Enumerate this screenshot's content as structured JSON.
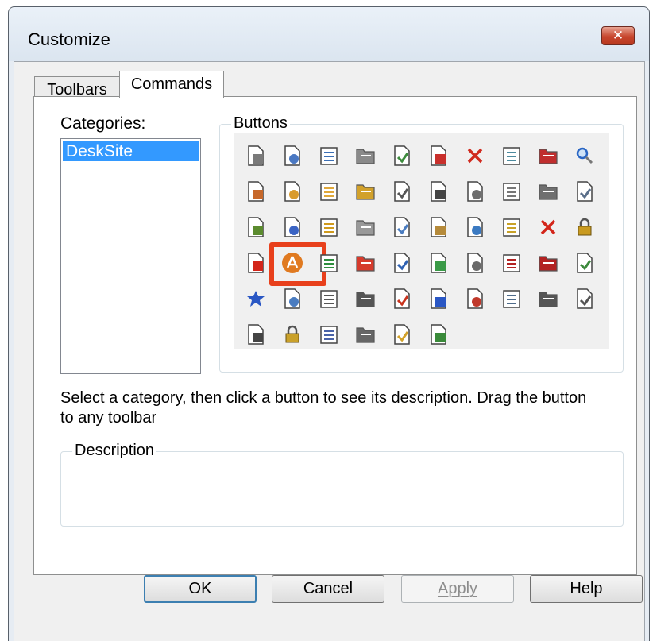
{
  "window": {
    "title": "Customize",
    "close_label": "✕"
  },
  "tabs": [
    {
      "label": "Toolbars",
      "active": false
    },
    {
      "label": "Commands",
      "active": true
    }
  ],
  "categories": {
    "label": "Categories:",
    "items": [
      "DeskSite"
    ],
    "selected": "DeskSite"
  },
  "buttons_group": {
    "label": "Buttons",
    "icons": [
      {
        "name": "print-icon",
        "color": "#7a7a7a"
      },
      {
        "name": "print-preview-icon",
        "color": "#4a78c2"
      },
      {
        "name": "refresh-document-icon",
        "color": "#3b6fb6"
      },
      {
        "name": "find-document-icon",
        "color": "#8a8a8a"
      },
      {
        "name": "document-export-icon",
        "color": "#3d8c3d"
      },
      {
        "name": "copy-document-icon",
        "color": "#c9302c"
      },
      {
        "name": "delete-document-icon",
        "color": "#d02a1e"
      },
      {
        "name": "database-document-icon",
        "color": "#4c8a9e"
      },
      {
        "name": "document-list-icon",
        "color": "#c02e2e"
      },
      {
        "name": "search-icon",
        "color": "#2a66c4"
      },
      {
        "name": "folder-photo-icon",
        "color": "#c7682a"
      },
      {
        "name": "folder-open-icon",
        "color": "#d89a2c"
      },
      {
        "name": "folder-icon",
        "color": "#e0a83a"
      },
      {
        "name": "print-queue-icon",
        "color": "#d2a12b"
      },
      {
        "name": "binoculars-icon",
        "color": "#555555"
      },
      {
        "name": "search-folder-icon",
        "color": "#444444"
      },
      {
        "name": "mail-document-icon",
        "color": "#6e6e6e"
      },
      {
        "name": "stacked-documents-icon",
        "color": "#777777"
      },
      {
        "name": "documents-icon",
        "color": "#6f6f6f"
      },
      {
        "name": "edit-document-icon",
        "color": "#5b6f8a"
      },
      {
        "name": "check-document-icon",
        "color": "#5b8b2e"
      },
      {
        "name": "forward-document-icon",
        "color": "#3b64c4"
      },
      {
        "name": "edit-pen-icon",
        "color": "#d09b1e"
      },
      {
        "name": "copy-outline-icon",
        "color": "#999999"
      },
      {
        "name": "paste-icon",
        "color": "#4a7cc0"
      },
      {
        "name": "hand-document-icon",
        "color": "#b58a3a"
      },
      {
        "name": "document-set-icon",
        "color": "#3b7ac2"
      },
      {
        "name": "new-document-icon",
        "color": "#c9a227"
      },
      {
        "name": "close-icon",
        "color": "#d3251a"
      },
      {
        "name": "lock-open-icon",
        "color": "#c99a1f"
      },
      {
        "name": "remove-document-icon",
        "color": "#d3251a"
      },
      {
        "name": "acrobat-icon",
        "color": "#e07a20"
      },
      {
        "name": "refresh-green-icon",
        "color": "#2e8f3e"
      },
      {
        "name": "pdf-icon",
        "color": "#d63b2c"
      },
      {
        "name": "word-document-icon",
        "color": "#2f62b3"
      },
      {
        "name": "add-document-icon",
        "color": "#3a9a47"
      },
      {
        "name": "text-document-icon",
        "color": "#6a6a6a"
      },
      {
        "name": "pdf-document-icon",
        "color": "#b32222"
      },
      {
        "name": "pdf-export-icon",
        "color": "#b32222"
      },
      {
        "name": "document-compare-icon",
        "color": "#3c8a3c"
      },
      {
        "name": "favorite-star-icon",
        "color": "#2a57c4"
      },
      {
        "name": "document-lines-icon",
        "color": "#4a7cc0"
      },
      {
        "name": "list-icon",
        "color": "#555555"
      },
      {
        "name": "copy-icon",
        "color": "#555555"
      },
      {
        "name": "schedule-icon",
        "color": "#c8331d"
      },
      {
        "name": "version-icon",
        "color": "#2a57c4"
      },
      {
        "name": "approve-icon",
        "color": "#c0392b"
      },
      {
        "name": "document-user-icon",
        "color": "#4e6b8a"
      },
      {
        "name": "document-text-icon",
        "color": "#555555"
      },
      {
        "name": "properties-icon",
        "color": "#555555"
      },
      {
        "name": "password-field-icon",
        "color": "#444444"
      },
      {
        "name": "padlock-icon",
        "color": "#caa12a"
      },
      {
        "name": "edit-table-icon",
        "color": "#4a63a8"
      },
      {
        "name": "new-sparkle-icon",
        "color": "#666666"
      },
      {
        "name": "mail-merge-icon",
        "color": "#d3a22a"
      },
      {
        "name": "sync-icon",
        "color": "#3a8a3a"
      }
    ]
  },
  "instruction": {
    "line1": "Select a category, then click a button to see its description. Drag the button",
    "line2": "to any toolbar"
  },
  "description_group": {
    "label": "Description",
    "text": ""
  },
  "actions": {
    "ok": "OK",
    "cancel": "Cancel",
    "apply": "Apply",
    "help": "Help"
  }
}
